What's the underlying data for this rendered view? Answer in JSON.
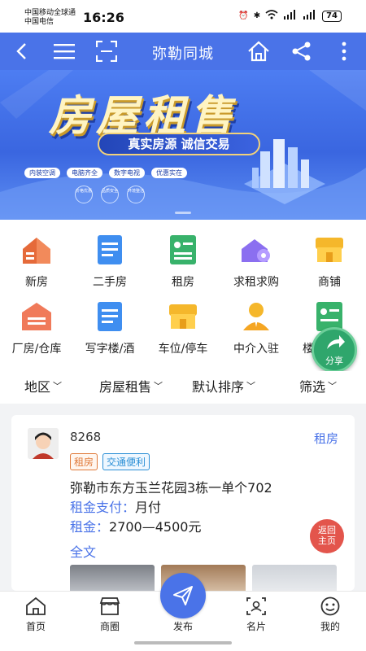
{
  "status_bar": {
    "carrier1": "中国移动全球通",
    "carrier2": "中国电信",
    "time": "16:26",
    "battery": "74"
  },
  "navbar": {
    "title": "弥勒同城",
    "bg_color": "#4a73e8"
  },
  "banner": {
    "title": "房屋租售",
    "slogan": "真实房源  诚信交易",
    "tags": [
      "内装空调",
      "电脑齐全",
      "数字电视",
      "优惠实在"
    ],
    "circles": [
      "价格优惠",
      "品质安全",
      "环境整洁"
    ]
  },
  "categories": [
    {
      "label": "新房",
      "icon": "house-icon"
    },
    {
      "label": "二手房",
      "icon": "document-icon"
    },
    {
      "label": "租房",
      "icon": "id-card-icon"
    },
    {
      "label": "求租求购",
      "icon": "house-key-icon"
    },
    {
      "label": "商铺",
      "icon": "shop-icon"
    },
    {
      "label": "厂房/仓库",
      "icon": "warehouse-icon"
    },
    {
      "label": "写字楼/酒",
      "icon": "document-icon"
    },
    {
      "label": "车位/停车",
      "icon": "shop-icon"
    },
    {
      "label": "中介入驻",
      "icon": "agent-icon"
    },
    {
      "label": "楼",
      "icon": "id-card-icon"
    }
  ],
  "share_fab": {
    "label": "分享"
  },
  "filters": [
    "地区",
    "房屋租售",
    "默认排序",
    "筛选"
  ],
  "listing": {
    "user": "8268",
    "type": "租房",
    "badges": [
      "租房",
      "交通便利"
    ],
    "address": "弥勒市东方玉兰花园3栋一单个702",
    "payment_label": "租金支付：",
    "payment_value": "月付",
    "rent_label": "租金：",
    "rent_value": "2700—4500元",
    "fulltext": "全文"
  },
  "back_home": {
    "line1": "返回",
    "line2": "主页"
  },
  "tabbar": [
    {
      "label": "首页",
      "icon": "home-icon"
    },
    {
      "label": "商圈",
      "icon": "store-icon"
    },
    {
      "label": "发布",
      "icon": "send-icon"
    },
    {
      "label": "名片",
      "icon": "card-icon"
    },
    {
      "label": "我的",
      "icon": "smile-icon"
    }
  ]
}
